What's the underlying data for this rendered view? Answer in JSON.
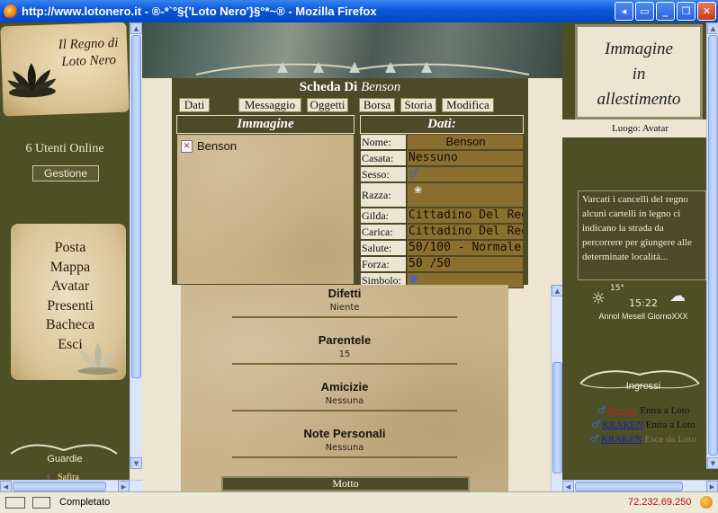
{
  "window": {
    "title": "http://www.lotonero.it - ®-*`°§{'Loto Nero'}§°*~® - Mozilla Firefox",
    "buttons": [
      "help",
      "tile",
      "minimize",
      "maximize",
      "close"
    ]
  },
  "left": {
    "logo_text": "Il Regno di Loto Nero",
    "users_online": "6 Utenti Online",
    "gestione_label": "Gestione",
    "menu": [
      "Posta",
      "Mappa",
      "Avatar",
      "Presenti",
      "Bacheca",
      "Esci"
    ],
    "guardie_label": "Guardie",
    "guard_name": "Safira",
    "guard_symbol": "♀"
  },
  "profile": {
    "title_prefix": "Scheda Di",
    "title_name": "Benson",
    "tabs": [
      "Dati",
      "Messaggio",
      "Oggetti",
      "Borsa",
      "Storia",
      "Modifica"
    ],
    "image_header": "Immagine",
    "data_header": "Dati:",
    "image_alt": "Benson",
    "fields": [
      {
        "label": "Nome:",
        "value": "Benson",
        "align": "center"
      },
      {
        "label": "Casata:",
        "value": "Nessuno"
      },
      {
        "label": "Sesso:",
        "value": "",
        "icon": "♂"
      },
      {
        "label": "Razza:",
        "value": "",
        "icon": "❀",
        "tall": true
      },
      {
        "label": "Gilda:",
        "value": "Cittadino Del Regno"
      },
      {
        "label": "Carica:",
        "value": "Cittadino Del Regno"
      },
      {
        "label": "Salute:",
        "value": "50/100 - Normale"
      },
      {
        "label": "Forza:",
        "value": "50 /50"
      },
      {
        "label": "Simbolo:",
        "value": "",
        "icon": "✽"
      }
    ],
    "sections": [
      {
        "title": "Difetti",
        "value": "Niente"
      },
      {
        "title": "Parentele",
        "value": "15"
      },
      {
        "title": "Amicizie",
        "value": "Nessuna"
      },
      {
        "title": "Note Personali",
        "value": "Nessuna"
      }
    ],
    "motto_label": "Motto"
  },
  "right": {
    "placeholder_lines": [
      "Immagine",
      "in",
      "allestimento"
    ],
    "luogo": "Luogo: Avatar",
    "news": "Varcati i cancelli del regno alcuni cartelli in legno ci indicano la strada da percorrere per giungere alle determinate località...",
    "temperature": "15°",
    "time": "15:22",
    "date": "Annol Mesell GiornoXXX",
    "ingressi_label": "Ingressi",
    "entries": [
      {
        "name": "Benson",
        "action": "Entra a Loto",
        "active": true
      },
      {
        "name": "KRAKEN",
        "action": "Entra a Loto",
        "active": false
      },
      {
        "name": "KRAKEN",
        "action": "Esce da Loto",
        "active": false
      }
    ],
    "entry_symbol": "♂"
  },
  "status": {
    "text": "Completato",
    "ip": "72.232.69.250"
  },
  "colors": {
    "frame_olive": "#4d4f24",
    "panel_dark": "#4d4a28",
    "cream": "#ebe5d2",
    "data_value": "#8c6e2e",
    "xp_title": "#0a56d8"
  }
}
